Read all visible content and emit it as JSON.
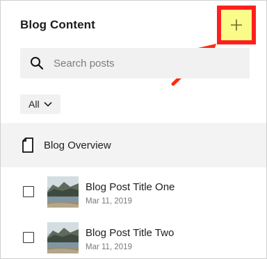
{
  "panel": {
    "title": "Blog Content",
    "add_icon": "plus-icon",
    "annotation_color": "#ff1f1f",
    "highlight_color": "#fafc8a"
  },
  "search": {
    "placeholder": "Search posts",
    "value": ""
  },
  "filter": {
    "label": "All"
  },
  "overview": {
    "label": "Blog Overview"
  },
  "posts": [
    {
      "title": "Blog Post Title One",
      "date": "Mar 11, 2019",
      "checked": false
    },
    {
      "title": "Blog Post Title Two",
      "date": "Mar 11, 2019",
      "checked": false
    }
  ]
}
